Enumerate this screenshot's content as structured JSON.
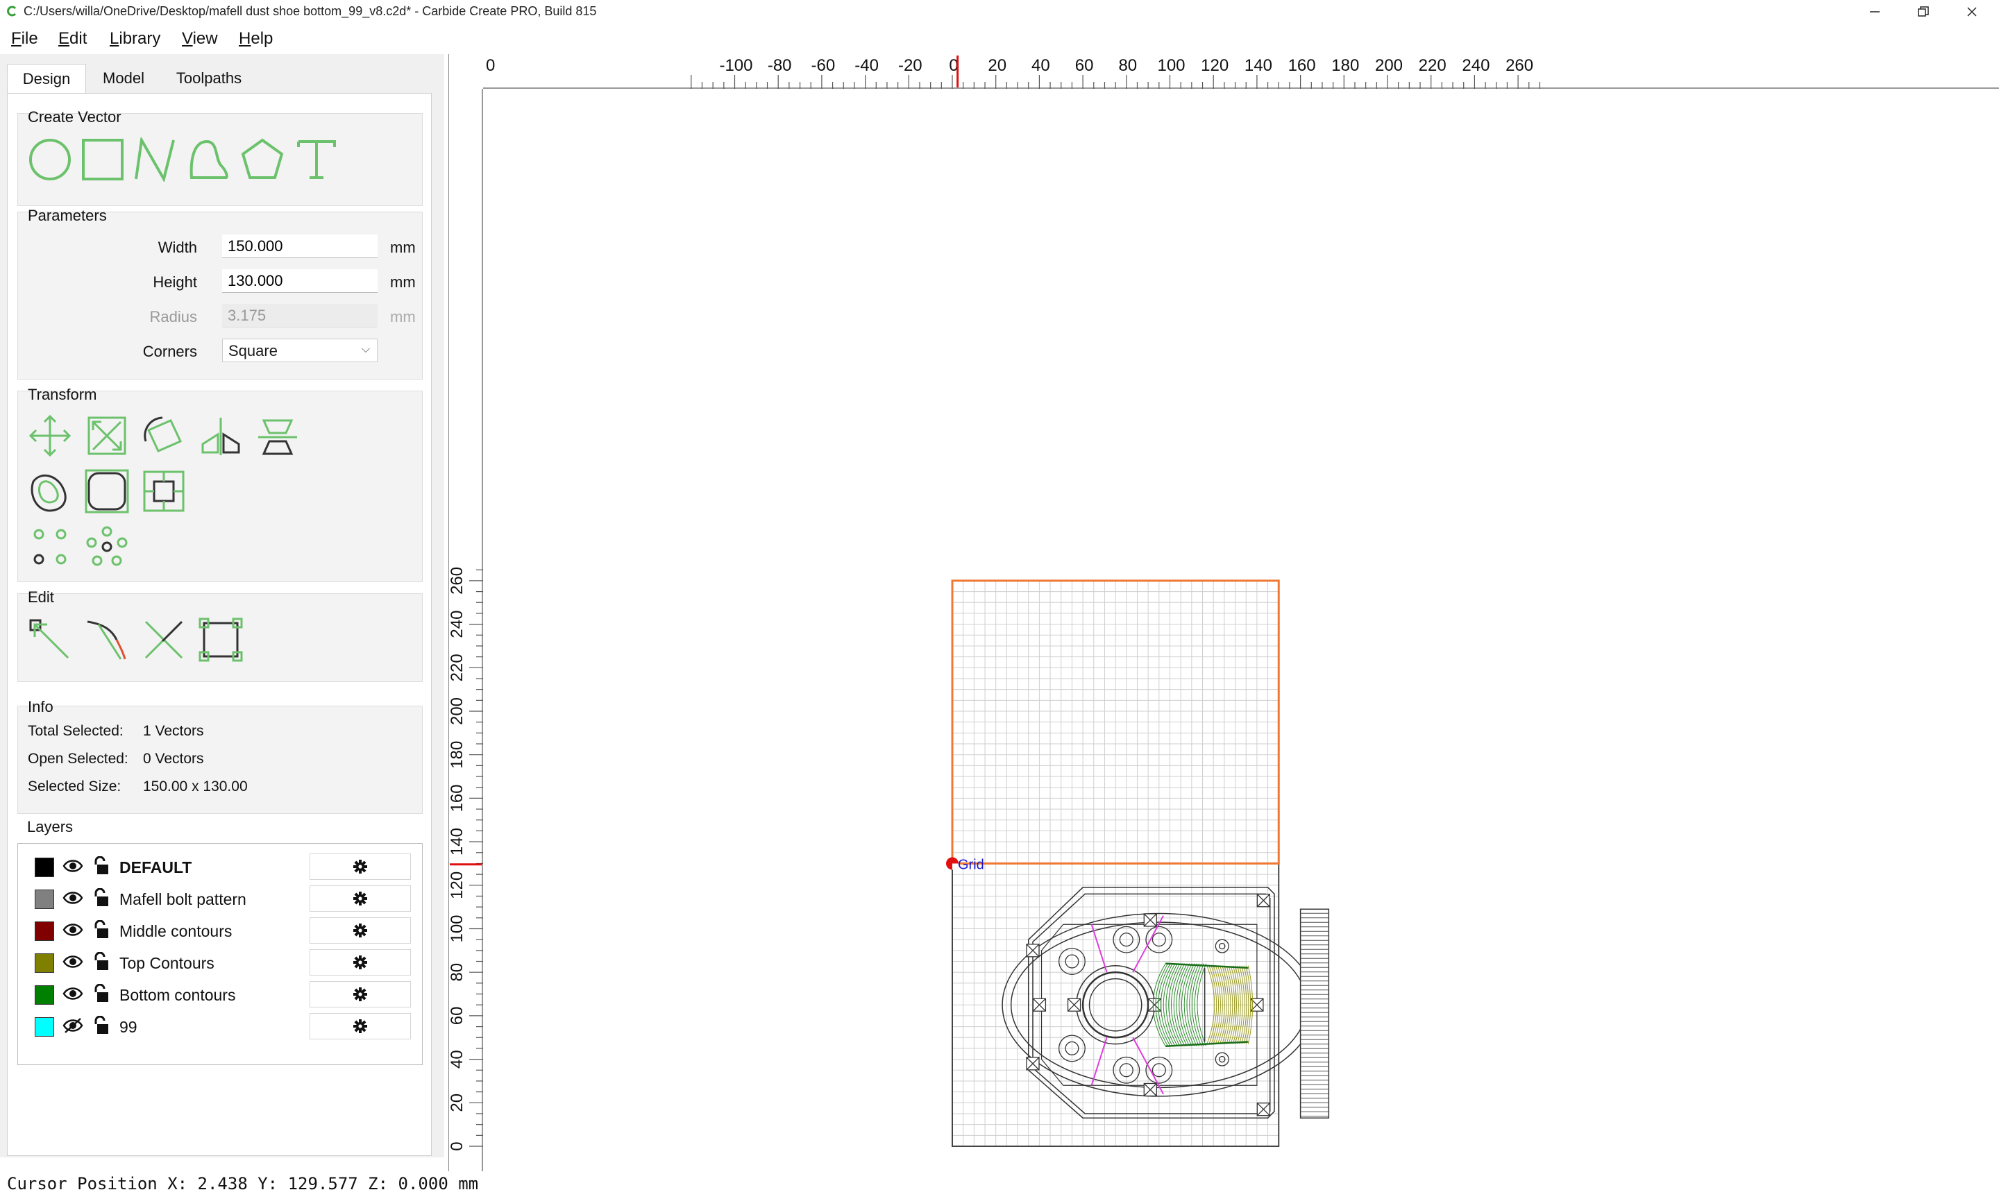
{
  "window": {
    "title": "C:/Users/willa/OneDrive/Desktop/mafell dust shoe bottom_99_v8.c2d* - Carbide Create PRO, Build 815",
    "controls": [
      "minimize",
      "restore",
      "close"
    ]
  },
  "menu": [
    {
      "label": "File",
      "key": "F",
      "rest": "ile"
    },
    {
      "label": "Edit",
      "key": "E",
      "rest": "dit"
    },
    {
      "label": "Library",
      "key": "L",
      "rest": "ibrary"
    },
    {
      "label": "View",
      "key": "V",
      "rest": "iew"
    },
    {
      "label": "Help",
      "key": "H",
      "rest": "elp"
    }
  ],
  "tabs": [
    "Design",
    "Model",
    "Toolpaths"
  ],
  "active_tab": "Design",
  "create_vector": {
    "title": "Create Vector",
    "tools": [
      "circle-icon",
      "rectangle-icon",
      "polyline-icon",
      "curve-icon",
      "polygon-icon",
      "text-icon"
    ]
  },
  "parameters": {
    "title": "Parameters",
    "width": {
      "label": "Width",
      "value": "150.000",
      "unit": "mm"
    },
    "height": {
      "label": "Height",
      "value": "130.000",
      "unit": "mm"
    },
    "radius": {
      "label": "Radius",
      "value": "3.175",
      "unit": "mm"
    },
    "corners": {
      "label": "Corners",
      "value": "Square"
    }
  },
  "transform": {
    "title": "Transform",
    "tools": [
      "move-icon",
      "scale-icon",
      "rotate-icon",
      "mirror-icon",
      "align-icon",
      "offset-icon",
      "fillet-icon",
      "boolean-icon",
      "array-icon",
      "circular-array-icon"
    ]
  },
  "edit": {
    "title": "Edit",
    "tools": [
      "node-edit-icon",
      "trim-icon",
      "cut-icon",
      "bounding-box-icon"
    ]
  },
  "info": {
    "title": "Info",
    "total_selected_label": "Total Selected:",
    "total_selected_value": "1 Vectors",
    "open_selected_label": "Open Selected:",
    "open_selected_value": "0 Vectors",
    "selected_size_label": "Selected Size:",
    "selected_size_value": "150.00 x 130.00"
  },
  "layers": {
    "title": "Layers",
    "items": [
      {
        "name": "DEFAULT",
        "color": "#000000",
        "visible": true,
        "bold": true
      },
      {
        "name": "Mafell bolt pattern",
        "color": "#808080",
        "visible": true,
        "bold": false
      },
      {
        "name": "Middle contours",
        "color": "#800000",
        "visible": true,
        "bold": false
      },
      {
        "name": "Top Contours",
        "color": "#808000",
        "visible": true,
        "bold": false
      },
      {
        "name": "Bottom contours",
        "color": "#008000",
        "visible": true,
        "bold": false
      },
      {
        "name": "99",
        "color": "#00ffff",
        "visible": false,
        "bold": false
      }
    ]
  },
  "ruler": {
    "x_labels": [
      "0",
      "-100",
      "-80",
      "-60",
      "-40",
      "-20",
      "0",
      "20",
      "40",
      "60",
      "80",
      "100",
      "120",
      "140",
      "160",
      "180",
      "200",
      "220",
      "240",
      "260"
    ],
    "y_labels": [
      "260",
      "240",
      "220",
      "200",
      "180",
      "160",
      "140",
      "120",
      "100",
      "80",
      "60",
      "40",
      "20",
      "0"
    ]
  },
  "canvas": {
    "grid_label": "Grid",
    "selection_color": "#f07830",
    "origin_marker_color": "#e01010"
  },
  "status": {
    "cursor_position": "Cursor Position X: 2.438 Y: 129.577 Z: 0.000 mm"
  }
}
